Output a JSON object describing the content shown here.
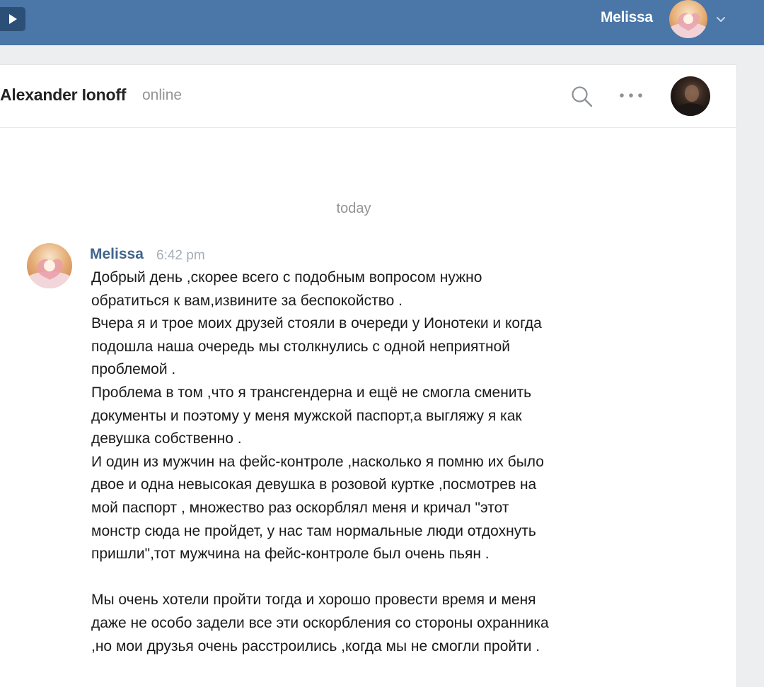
{
  "topbar": {
    "user_name": "Melissa",
    "menu_icon": "play-icon",
    "chevron_icon": "chevron-down-icon"
  },
  "conversation": {
    "contact_name": "Alexander Ionoff",
    "contact_status": "online",
    "search_icon": "search-icon",
    "more_icon": "more-icon"
  },
  "messages": {
    "day_divider": "today",
    "items": [
      {
        "author": "Melissa",
        "time": "6:42 pm",
        "lines": [
          "Добрый день ,скорее всего с подобным вопросом нужно",
          "обратиться к вам,извините за беспокойство .",
          "Вчера я и трое моих друзей стояли в очереди у Ионотеки и когда",
          "подошла наша очередь мы столкнулись с одной неприятной",
          "проблемой .",
          "Проблема в том ,что я трансгендерна и ещё не смогла сменить",
          "документы и поэтому у меня мужской паспорт,а выгляжу я как",
          "девушка собственно .",
          "И один из мужчин на фейс-контроле ,насколько я помню их было",
          "двое и одна невысокая девушка в розовой куртке ,посмотрев на",
          "мой паспорт , множество раз оскорблял меня и кричал \"этот",
          "монстр сюда не пройдет, у нас там нормальные люди отдохнуть",
          "пришли\",тот мужчина на фейс-контроле был очень пьян .",
          "",
          "Мы очень хотели пройти тогда и хорошо провести время и меня",
          "даже не особо задели все эти оскорбления со стороны охранника",
          ",но мои друзья очень расстроились ,когда мы не смогли пройти ."
        ]
      }
    ]
  },
  "colors": {
    "header_bg": "#4a76a8",
    "page_bg": "#edeef0",
    "author_link": "#42648b",
    "muted_text": "#939393"
  }
}
